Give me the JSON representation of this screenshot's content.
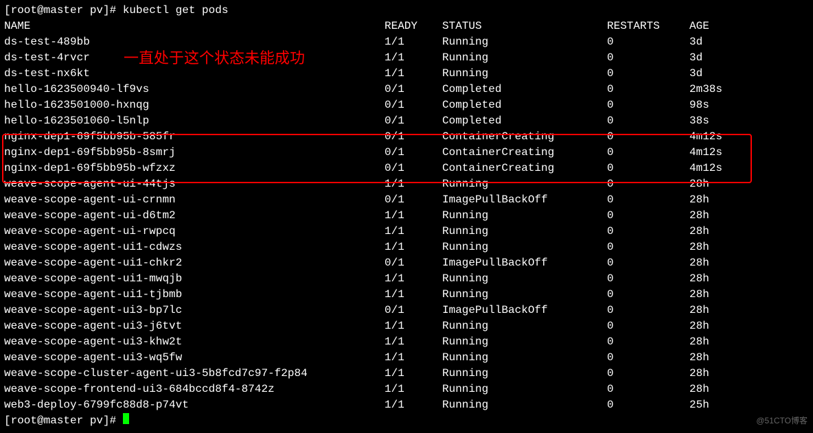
{
  "prompt1": "[root@master pv]# ",
  "command": "kubectl get pods",
  "prompt2": "[root@master pv]# ",
  "headers": {
    "name": "NAME",
    "ready": "READY",
    "status": "STATUS",
    "restarts": "RESTARTS",
    "age": "AGE"
  },
  "annotation_text": "一直处于这个状态未能成功",
  "watermark": "@51CTO博客",
  "rows": [
    {
      "name": "ds-test-489bb",
      "ready": "1/1",
      "status": "Running",
      "restarts": "0",
      "age": "3d"
    },
    {
      "name": "ds-test-4rvcr",
      "ready": "1/1",
      "status": "Running",
      "restarts": "0",
      "age": "3d"
    },
    {
      "name": "ds-test-nx6kt",
      "ready": "1/1",
      "status": "Running",
      "restarts": "0",
      "age": "3d"
    },
    {
      "name": "hello-1623500940-lf9vs",
      "ready": "0/1",
      "status": "Completed",
      "restarts": "0",
      "age": "2m38s"
    },
    {
      "name": "hello-1623501000-hxnqg",
      "ready": "0/1",
      "status": "Completed",
      "restarts": "0",
      "age": "98s"
    },
    {
      "name": "hello-1623501060-l5nlp",
      "ready": "0/1",
      "status": "Completed",
      "restarts": "0",
      "age": "38s"
    },
    {
      "name": "nginx-dep1-69f5bb95b-585fr",
      "ready": "0/1",
      "status": "ContainerCreating",
      "restarts": "0",
      "age": "4m12s"
    },
    {
      "name": "nginx-dep1-69f5bb95b-8smrj",
      "ready": "0/1",
      "status": "ContainerCreating",
      "restarts": "0",
      "age": "4m12s"
    },
    {
      "name": "nginx-dep1-69f5bb95b-wfzxz",
      "ready": "0/1",
      "status": "ContainerCreating",
      "restarts": "0",
      "age": "4m12s"
    },
    {
      "name": "weave-scope-agent-ui-44tjs",
      "ready": "1/1",
      "status": "Running",
      "restarts": "0",
      "age": "28h"
    },
    {
      "name": "weave-scope-agent-ui-crnmn",
      "ready": "0/1",
      "status": "ImagePullBackOff",
      "restarts": "0",
      "age": "28h"
    },
    {
      "name": "weave-scope-agent-ui-d6tm2",
      "ready": "1/1",
      "status": "Running",
      "restarts": "0",
      "age": "28h"
    },
    {
      "name": "weave-scope-agent-ui-rwpcq",
      "ready": "1/1",
      "status": "Running",
      "restarts": "0",
      "age": "28h"
    },
    {
      "name": "weave-scope-agent-ui1-cdwzs",
      "ready": "1/1",
      "status": "Running",
      "restarts": "0",
      "age": "28h"
    },
    {
      "name": "weave-scope-agent-ui1-chkr2",
      "ready": "0/1",
      "status": "ImagePullBackOff",
      "restarts": "0",
      "age": "28h"
    },
    {
      "name": "weave-scope-agent-ui1-mwqjb",
      "ready": "1/1",
      "status": "Running",
      "restarts": "0",
      "age": "28h"
    },
    {
      "name": "weave-scope-agent-ui1-tjbmb",
      "ready": "1/1",
      "status": "Running",
      "restarts": "0",
      "age": "28h"
    },
    {
      "name": "weave-scope-agent-ui3-bp7lc",
      "ready": "0/1",
      "status": "ImagePullBackOff",
      "restarts": "0",
      "age": "28h"
    },
    {
      "name": "weave-scope-agent-ui3-j6tvt",
      "ready": "1/1",
      "status": "Running",
      "restarts": "0",
      "age": "28h"
    },
    {
      "name": "weave-scope-agent-ui3-khw2t",
      "ready": "1/1",
      "status": "Running",
      "restarts": "0",
      "age": "28h"
    },
    {
      "name": "weave-scope-agent-ui3-wq5fw",
      "ready": "1/1",
      "status": "Running",
      "restarts": "0",
      "age": "28h"
    },
    {
      "name": "weave-scope-cluster-agent-ui3-5b8fcd7c97-f2p84",
      "ready": "1/1",
      "status": "Running",
      "restarts": "0",
      "age": "28h"
    },
    {
      "name": "weave-scope-frontend-ui3-684bccd8f4-8742z",
      "ready": "1/1",
      "status": "Running",
      "restarts": "0",
      "age": "28h"
    },
    {
      "name": "web3-deploy-6799fc88d8-p74vt",
      "ready": "1/1",
      "status": "Running",
      "restarts": "0",
      "age": "25h"
    }
  ]
}
